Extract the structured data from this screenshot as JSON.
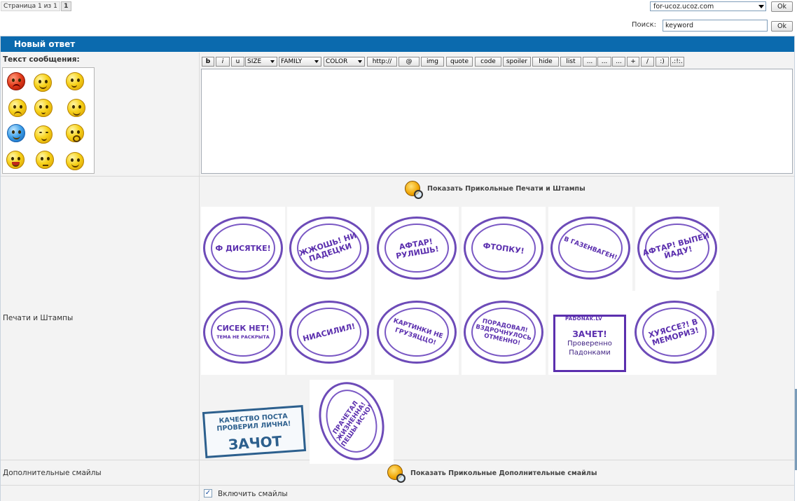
{
  "pager": {
    "label": "Страница 1 из 1",
    "current": "1"
  },
  "site_select": {
    "value": "for-ucoz.ucoz.com",
    "ok": "Ok"
  },
  "search": {
    "label": "Поиск:",
    "value": "keyword",
    "ok": "Ok"
  },
  "form": {
    "title": "Новый ответ",
    "message_label": "Текст сообщения:",
    "toolbar": [
      "b",
      "i",
      "u",
      "SIZE",
      "FAMILY",
      "COLOR",
      "http://",
      "@",
      "img",
      "quote",
      "code",
      "spoiler",
      "hide",
      "list",
      "...",
      "...",
      "...",
      "+",
      "/",
      ":)",
      ".:!:."
    ],
    "stamps_label": "Печати и Штампы",
    "stamps_link": "Показать Прикольные Печати и Штампы",
    "stamps": [
      "Ф ДИСЯТКЕ!",
      "ЖЖОШЬ! НИ ПАДЕЦКИ",
      "АФТАР! РУЛИШЬ!",
      "ФТОПКУ!",
      "В ГАЗЕНВАГЕН!",
      "АФТАР! ВЫПЕЙ ЙАДУ!",
      "СИСЕК НЕТ!",
      "НИАСИЛИЛ!",
      "КАРТИНКИ НЕ ГРУЗЯЦЦО!",
      "ПОРАДОВАЛ! ВЗДРОЧНУЛОСЬ ОТМЕННО!",
      "ЗАЧЕТ!",
      "ХУЯССЕ?! В МЕМОРИЗ!",
      "ЗАЧОТ",
      "ПРАЧЕТАЛ ЖИЗНЕННА! ПЕШЫ ИСЧО!"
    ],
    "stamp_sub": "ТЕМА НЕ РАСКРЫТА",
    "padonak_side": "PADONAK.LV",
    "padonak_text": "Проверенно Падонками",
    "quality_text": "КАЧЕСТВО ПОСТА ПРОВЕРИЛ ЛИЧНА!",
    "smiles_label": "Дополнительные смайлы",
    "smiles_link": "Показать Прикольные Дополнительные смайлы",
    "enable_smiles": "Включить смайлы"
  },
  "icons": {
    "bee": "bee-magnifier-icon",
    "dropdown": "chevron-down-icon",
    "check": "checkbox-checked-icon"
  },
  "colors": {
    "header_bg": "#0b6aae",
    "stamp_purple": "#5b2fae",
    "stamp_blue": "#2c5f8d"
  }
}
